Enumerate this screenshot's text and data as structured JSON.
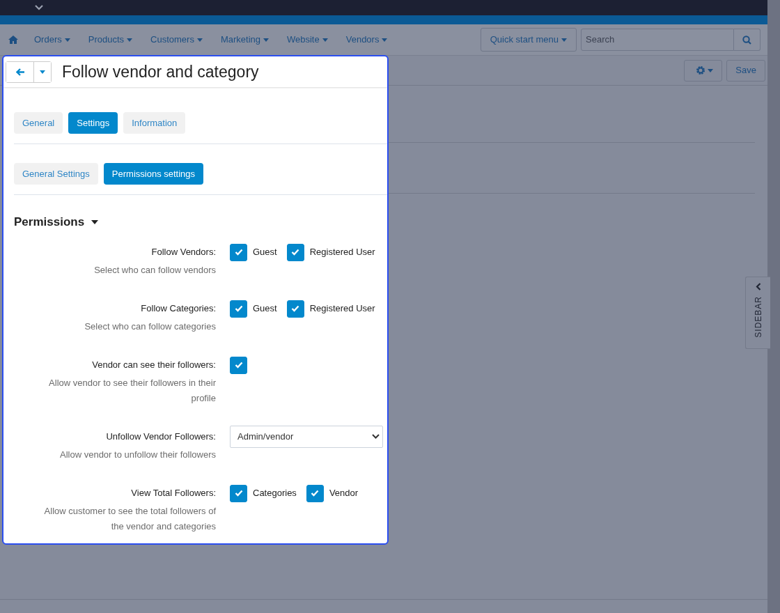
{
  "nav": {
    "menus": [
      {
        "label": "Orders"
      },
      {
        "label": "Products"
      },
      {
        "label": "Customers"
      },
      {
        "label": "Marketing"
      },
      {
        "label": "Website"
      },
      {
        "label": "Vendors"
      }
    ],
    "quick_start": "Quick start menu",
    "search": {
      "placeholder": "Search"
    }
  },
  "toolbar": {
    "save": "Save"
  },
  "sidebar_tab": "SIDEBAR",
  "panel": {
    "title": "Follow vendor and category",
    "tabs": [
      {
        "label": "General",
        "selected": false
      },
      {
        "label": "Settings",
        "selected": true
      },
      {
        "label": "Information",
        "selected": false
      }
    ],
    "subtabs": [
      {
        "label": "General Settings",
        "selected": false
      },
      {
        "label": "Permissions settings",
        "selected": true
      }
    ],
    "section": {
      "title": "Permissions",
      "expanded": true
    },
    "fields": [
      {
        "kind": "checkboxes",
        "label": "Follow Vendors:",
        "help": "Select who can follow vendors",
        "options": [
          {
            "label": "Guest",
            "checked": true
          },
          {
            "label": "Registered User",
            "checked": true
          }
        ]
      },
      {
        "kind": "checkboxes",
        "label": "Follow Categories:",
        "help": "Select who can follow categories",
        "options": [
          {
            "label": "Guest",
            "checked": true
          },
          {
            "label": "Registered User",
            "checked": true
          }
        ]
      },
      {
        "kind": "checkbox",
        "label": "Vendor can see their followers:",
        "help": "Allow vendor to see their followers in their profile",
        "checked": true
      },
      {
        "kind": "select",
        "label": "Unfollow Vendor Followers:",
        "help": "Allow vendor to unfollow their followers",
        "value": "Admin/vendor"
      },
      {
        "kind": "checkboxes",
        "label": "View Total Followers:",
        "help": "Allow customer to see the total followers of the vendor and categories",
        "options": [
          {
            "label": "Categories",
            "checked": true
          },
          {
            "label": "Vendor",
            "checked": true
          }
        ]
      }
    ]
  }
}
